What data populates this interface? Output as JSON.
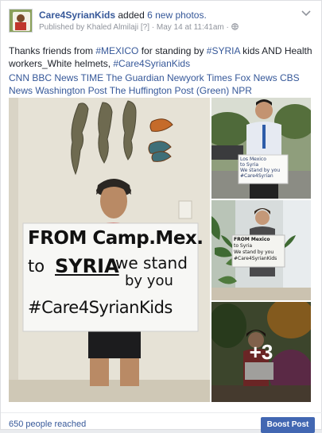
{
  "post": {
    "page_name": "Care4SyrianKids",
    "action_text": " added ",
    "photos_link": "6 new photos.",
    "published_by": "Published by Khaled Almilaji",
    "badge": "[?]",
    "date": "· May 14 at 11:41am ·",
    "globe_icon": "globe-icon",
    "menu_icon": "chevron-down-icon"
  },
  "message": {
    "part1": "Thanks friends from ",
    "tag_mexico": "#MEXICO",
    "part2": " for standing by ",
    "tag_syria": "#SYRIA",
    "part3": " kids AND Health workers_White helmets, ",
    "tag_care": "#Care4SyrianKids",
    "news_line": "CNN BBC News TIME The Guardian Newyork Times Fox News CBS News Washington Post The Huffington Post (Green) NPR"
  },
  "photos": {
    "main_sign": {
      "line1": "FROM Camp.Mex.",
      "line2a": "to",
      "line2b": "SYRIA",
      "line2c": "we stand",
      "line3": "by you",
      "line4": "#Care4SyrianKids"
    },
    "sign_r1": {
      "line1": "Los Mexico",
      "line2": "to Syria",
      "line3": "We stand by you",
      "line4": "#Care4Syrian"
    },
    "sign_r2": {
      "line1": "FROM Mexico",
      "line2": "to Syria",
      "line3": "We stand by you",
      "line4": "#Care4SyrianKids"
    },
    "more_count": "+3"
  },
  "footer": {
    "reach": "650 people reached",
    "boost_label": "Boost Post"
  },
  "colors": {
    "link": "#365899",
    "boost_bg": "#4267b2",
    "meta": "#90949c"
  }
}
